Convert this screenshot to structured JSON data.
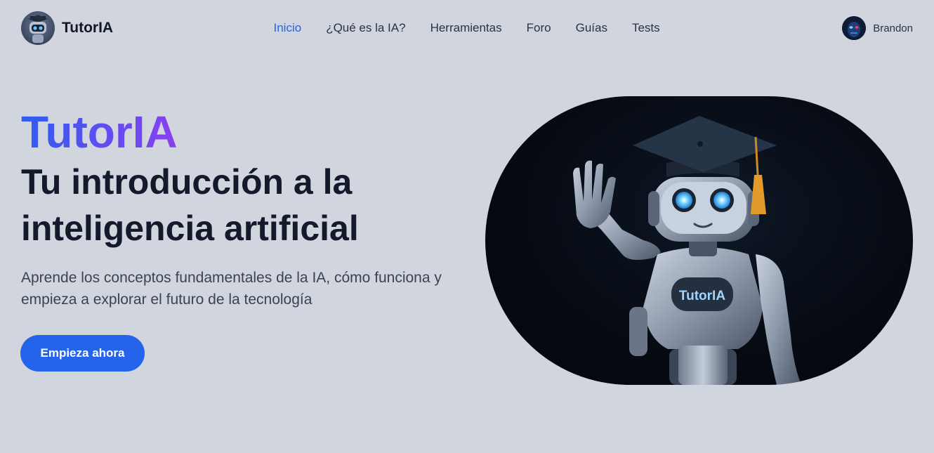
{
  "header": {
    "brand": "TutorIA",
    "nav": [
      {
        "label": "Inicio",
        "active": true
      },
      {
        "label": "¿Qué es la IA?",
        "active": false
      },
      {
        "label": "Herramientas",
        "active": false
      },
      {
        "label": "Foro",
        "active": false
      },
      {
        "label": "Guías",
        "active": false
      },
      {
        "label": "Tests",
        "active": false
      }
    ],
    "user": {
      "name": "Brandon"
    }
  },
  "hero": {
    "brand_title": "TutorIA",
    "headline": "Tu introducción a la inteligencia artificial",
    "subtitle": "Aprende los conceptos fundamentales de la IA, cómo funciona y empieza a explorar el futuro de la tecnología",
    "cta_label": "Empieza ahora",
    "robot_chest_label": "TutorIA"
  },
  "colors": {
    "background": "#d1d5de",
    "accent": "#2563eb",
    "gradient_start": "#2f5ef0",
    "gradient_end": "#8a3ff0",
    "text_dark": "#141a2b"
  },
  "icons": {
    "logo": "robot-graduate-icon",
    "avatar": "user-avatar-icon"
  }
}
